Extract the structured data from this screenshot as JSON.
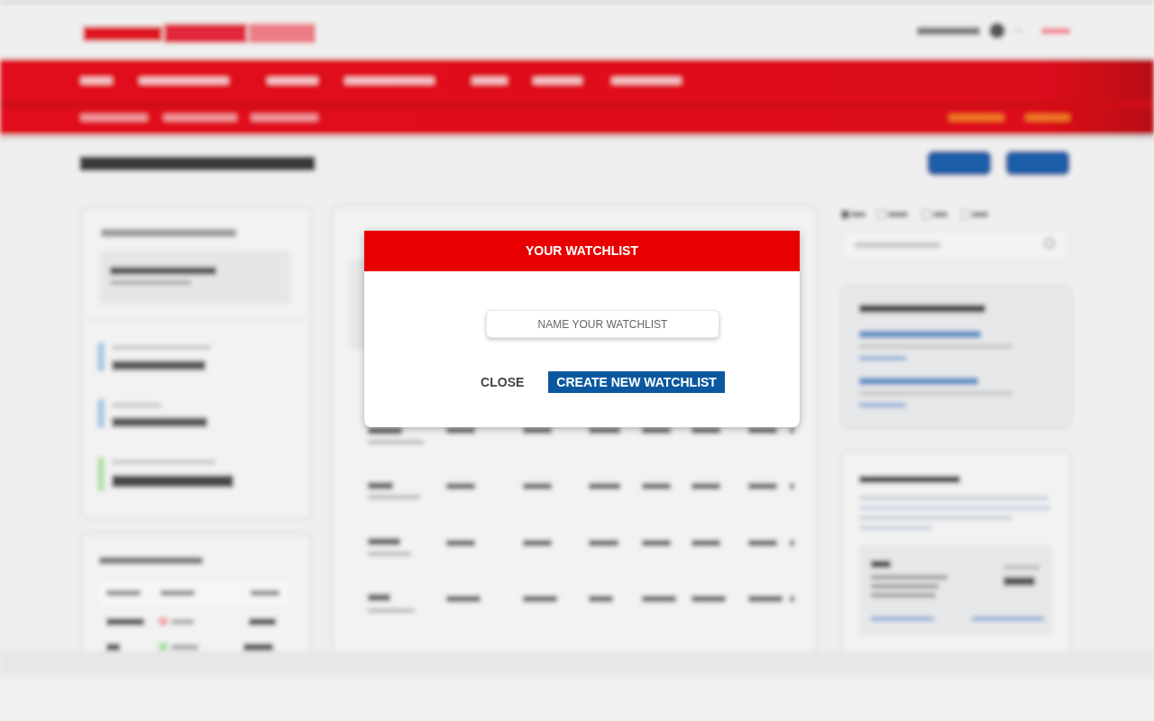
{
  "modal": {
    "title": "YOUR WATCHLIST",
    "name_field": {
      "placeholder": "NAME YOUR WATCHLIST"
    },
    "buttons": [
      {
        "label": "CLOSE",
        "kind": "plain"
      },
      {
        "label": "CREATE NEW WATCHLIST",
        "kind": "primary"
      }
    ]
  }
}
